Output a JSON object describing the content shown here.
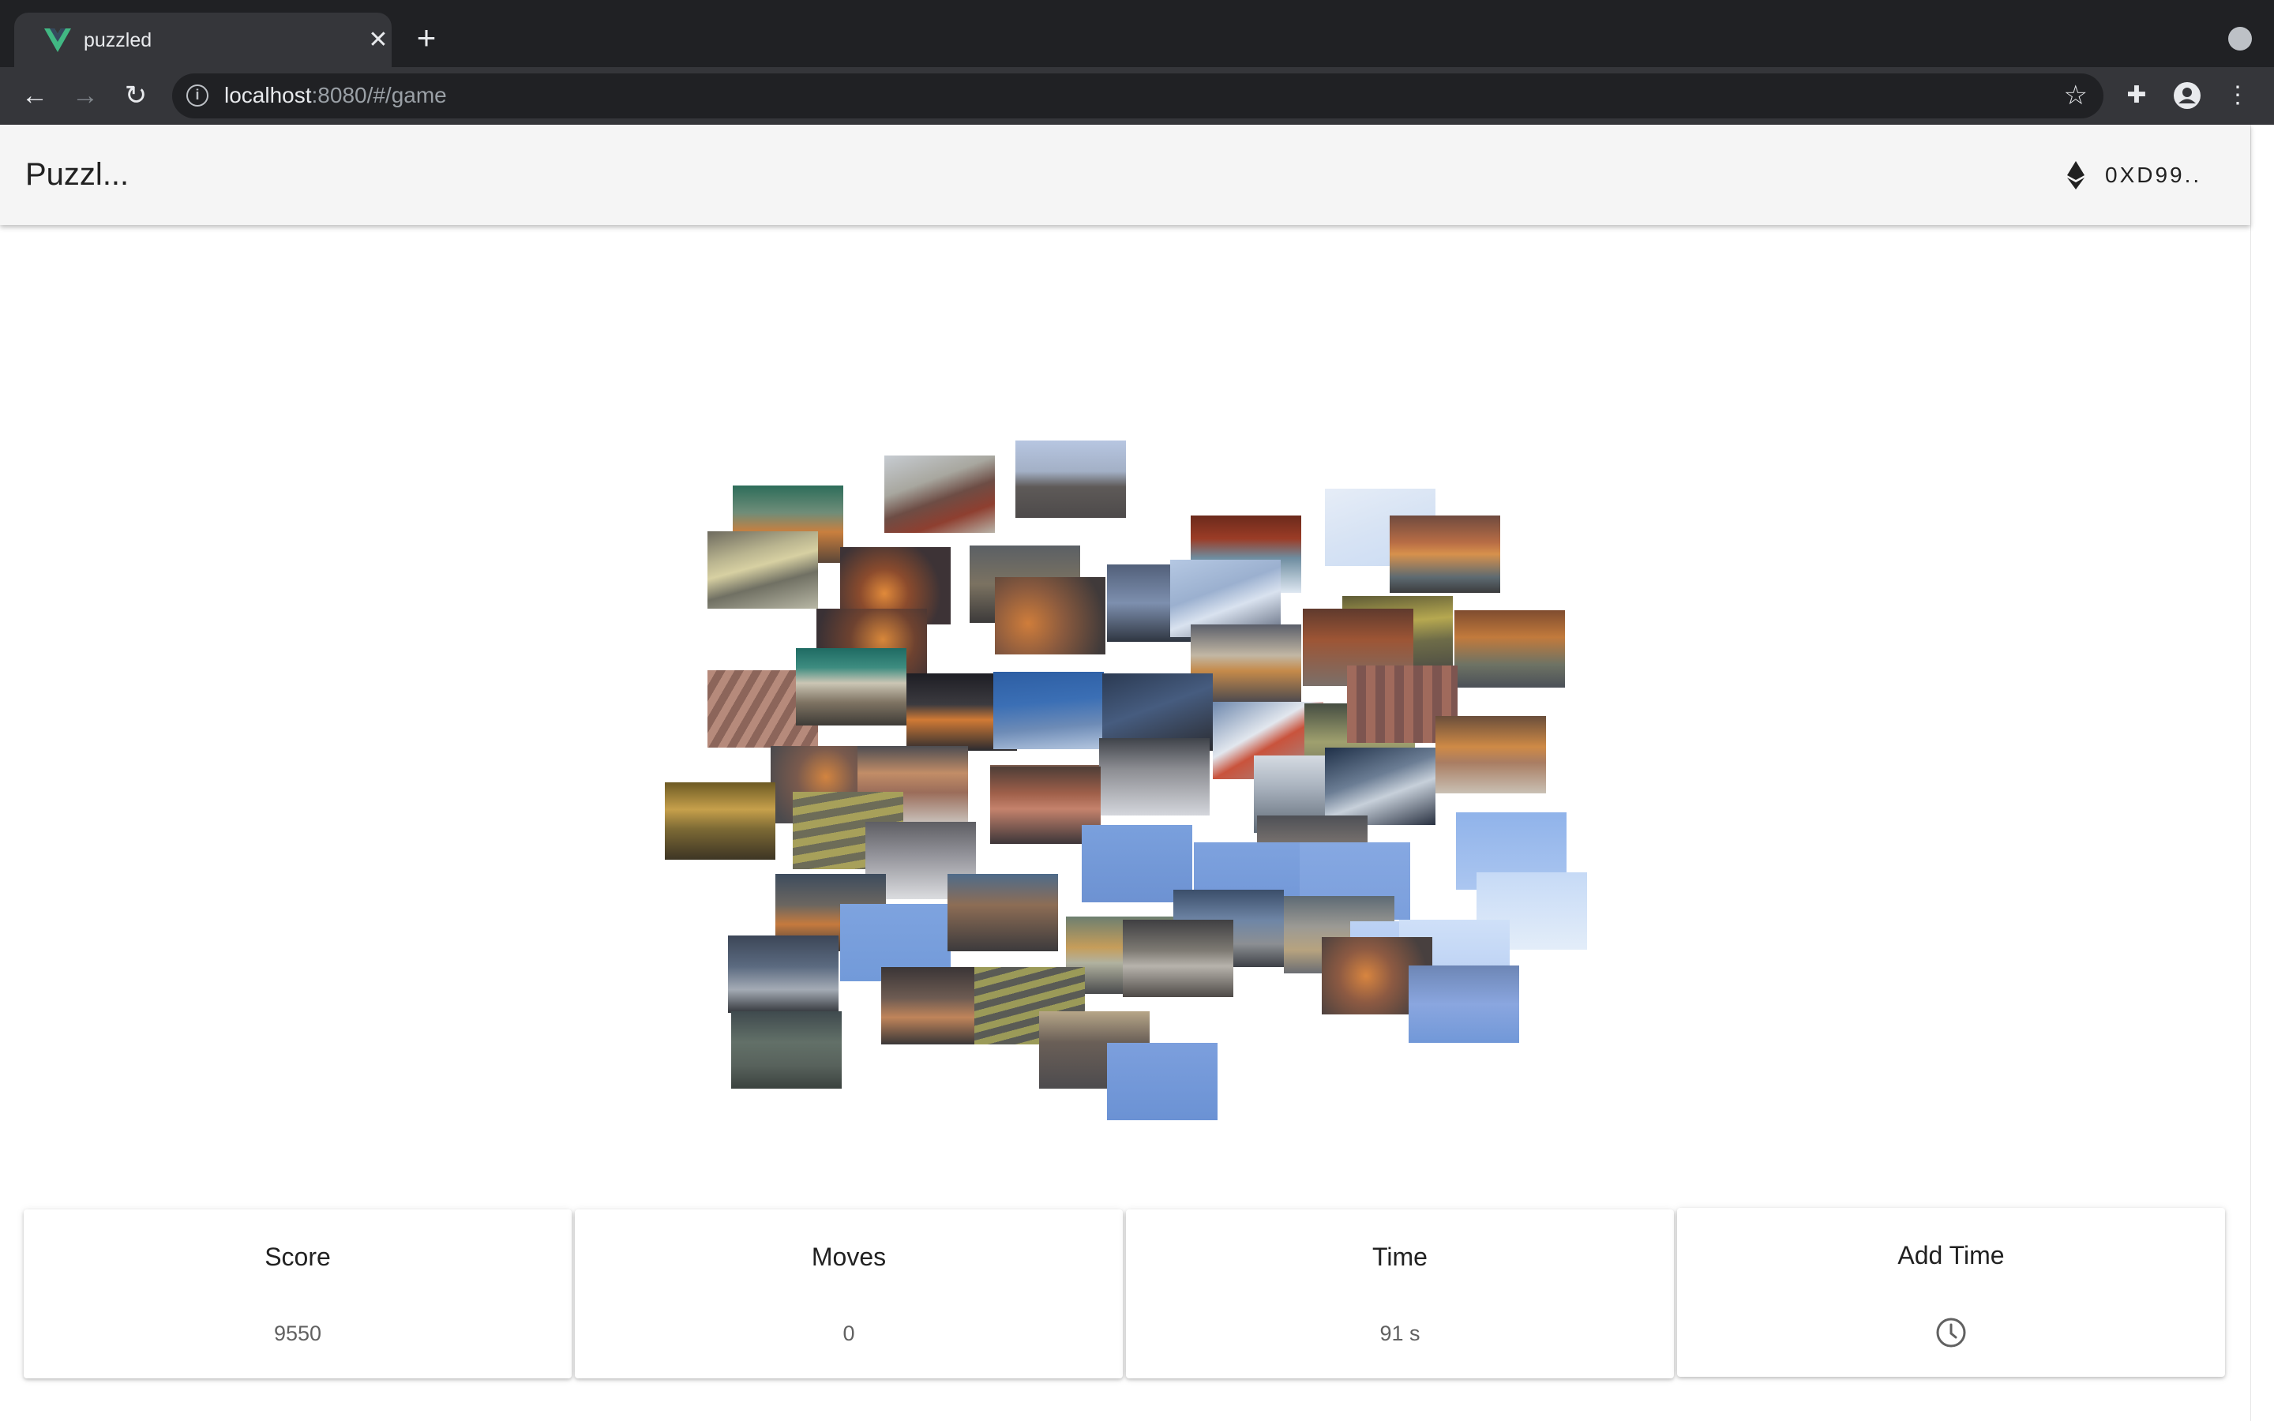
{
  "browser": {
    "tab_title": "puzzled",
    "url_host": "localhost",
    "url_rest": ":8080/#/game"
  },
  "appbar": {
    "title": "Puzzl...",
    "wallet_label": "0XD99.."
  },
  "stats": {
    "score_label": "Score",
    "score_value": "9550",
    "moves_label": "Moves",
    "moves_value": "0",
    "time_label": "Time",
    "time_value": "91 s",
    "add_time_label": "Add Time"
  },
  "colors": {
    "vue_green": "#41b883",
    "vue_dark": "#35495e",
    "sky_blue": "#7a9ed8",
    "night_dark": "#3a3a3f",
    "city_orange": "#c4783a"
  },
  "icons": {
    "wallet": "ethereum-icon",
    "add_time": "clock-icon"
  }
}
